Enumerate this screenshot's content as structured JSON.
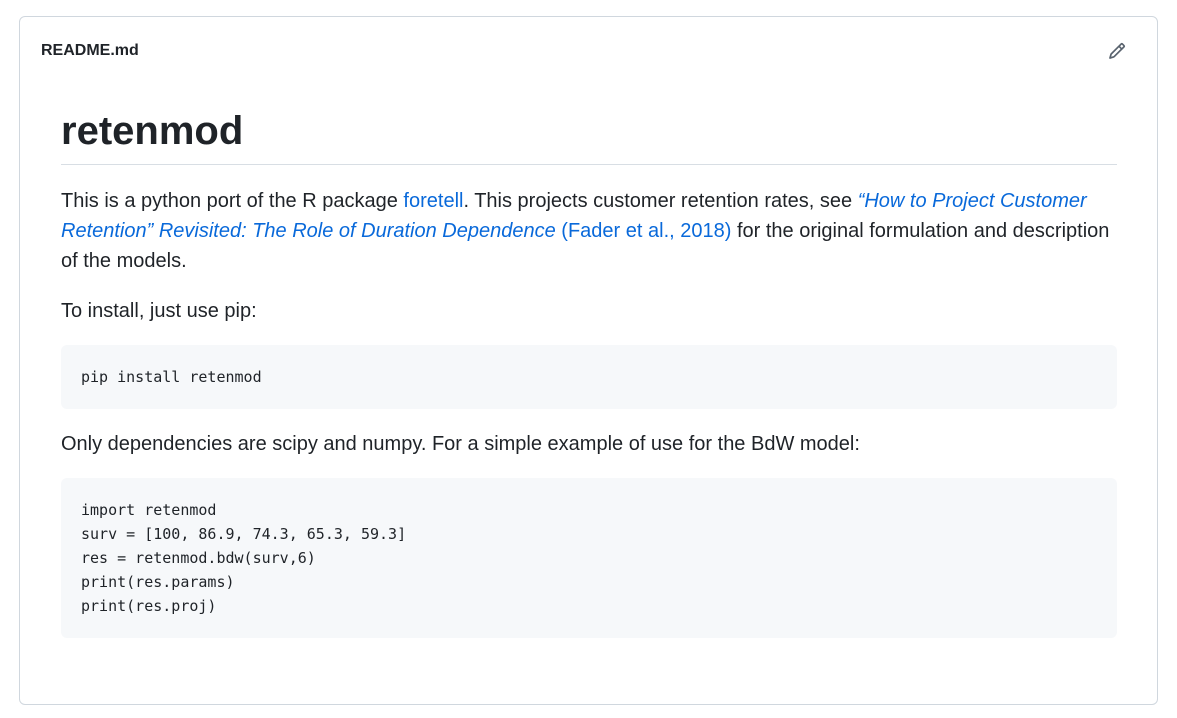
{
  "readme": {
    "filename": "README.md",
    "edit_icon": "pencil-icon",
    "title": "retenmod",
    "intro": {
      "text_1": "This is a python port of the R package ",
      "link_foretell": "foretell",
      "text_2": ". This projects customer retention rates, see ",
      "link_paper": "“How to Project Customer Retention” Revisited: The Role of Duration Dependence",
      "text_3": " ",
      "link_citation": "(Fader et al., 2018)",
      "text_4": " for the original formulation and description of the models."
    },
    "install_text": "To install, just use pip:",
    "install_code": "pip install retenmod",
    "deps_text": "Only dependencies are scipy and numpy. For a simple example of use for the BdW model:",
    "example_code": [
      "import retenmod",
      "surv = [100, 86.9, 74.3, 65.3, 59.3]",
      "res = retenmod.bdw(surv,6)",
      "print(res.params)",
      "print(res.proj)"
    ],
    "colors": {
      "link": "#0969da",
      "text": "#1f2328",
      "code_bg": "#f6f8fa",
      "border": "#d0d7de"
    }
  }
}
